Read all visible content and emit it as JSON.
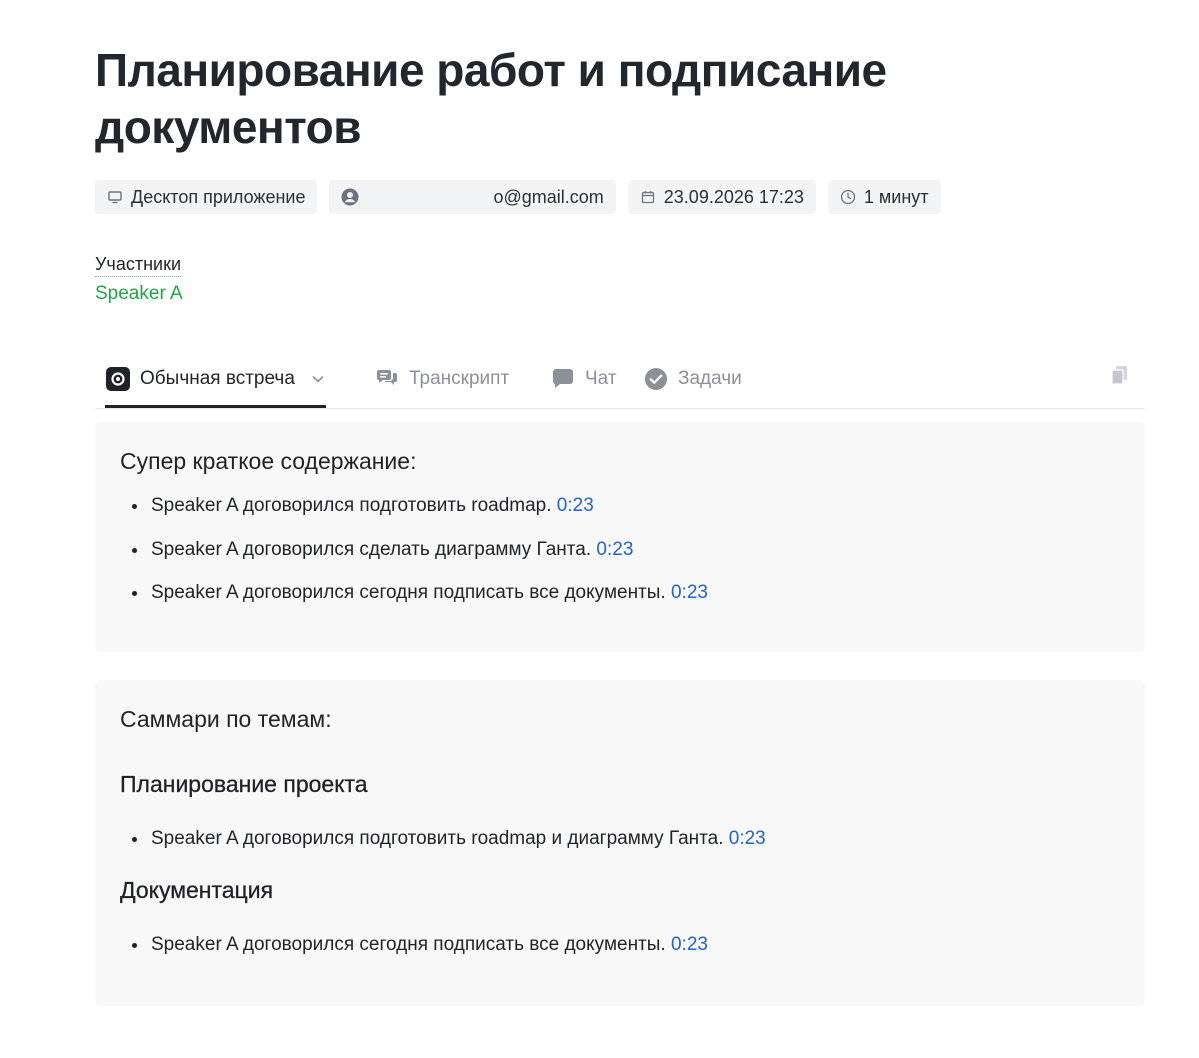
{
  "meeting": {
    "title": "Планирование работ и подписание документов"
  },
  "meta": {
    "source": {
      "label": "Десктоп приложение",
      "icon": "monitor-icon"
    },
    "user": {
      "email": "o@gmail.com",
      "icon": "user-circle-icon"
    },
    "date": {
      "label": "23.09.2026 17:23",
      "icon": "calendar-icon"
    },
    "duration": {
      "label": "1 минут",
      "icon": "clock-icon"
    }
  },
  "participants": {
    "label": "Участники",
    "items": [
      "Speaker A"
    ]
  },
  "tabs": [
    {
      "label": "Обычная встреча",
      "icon": "record-icon",
      "active": true
    },
    {
      "label": "Транскрипт",
      "icon": "speech-bubbles-icon",
      "active": false
    },
    {
      "label": "Чат",
      "icon": "chat-bubble-icon",
      "active": false
    },
    {
      "label": "Задачи",
      "icon": "check-circle-icon",
      "active": false
    }
  ],
  "summary": {
    "heading": "Супер краткое содержание:",
    "items": [
      {
        "text": "Speaker A договорился подготовить roadmap.",
        "time": "0:23"
      },
      {
        "text": "Speaker A договорился сделать диаграмму Ганта.",
        "time": "0:23"
      },
      {
        "text": "Speaker A договорился сегодня подписать все документы.",
        "time": "0:23"
      }
    ]
  },
  "topics": {
    "heading": "Саммари по темам:",
    "sections": [
      {
        "title": "Планирование проекта",
        "items": [
          {
            "text": "Speaker A договорился подготовить roadmap и диаграмму Ганта.",
            "time": "0:23"
          }
        ]
      },
      {
        "title": "Документация",
        "items": [
          {
            "text": "Speaker A договорился сегодня подписать все документы.",
            "time": "0:23"
          }
        ]
      }
    ]
  },
  "colors": {
    "accent_link": "#2463c8",
    "participant": "#22a447",
    "card_bg": "#f8f8f9"
  }
}
